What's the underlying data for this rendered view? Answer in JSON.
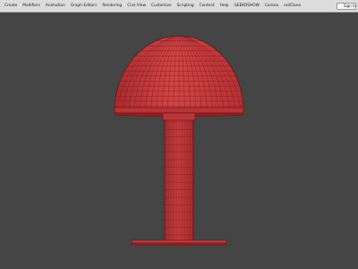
{
  "menubar": {
    "items": [
      {
        "label": "Create"
      },
      {
        "label": "Modifiers"
      },
      {
        "label": "Animation"
      },
      {
        "label": "Graph Editors"
      },
      {
        "label": "Rendering"
      },
      {
        "label": "Civil View"
      },
      {
        "label": "Customize"
      },
      {
        "label": "Scripting"
      },
      {
        "label": "Content"
      },
      {
        "label": "Help"
      },
      {
        "label": "GEEKOSHOW"
      },
      {
        "label": "Corona"
      },
      {
        "label": "railClone"
      }
    ],
    "signin_label": "Sign in"
  },
  "icons": {
    "signin": "user-icon"
  },
  "colors": {
    "viewport_bg": "#454545",
    "mesh_fill": "#c0393b",
    "mesh_wire": "#6e1010",
    "menubar_bg": "#dcdcdc"
  }
}
